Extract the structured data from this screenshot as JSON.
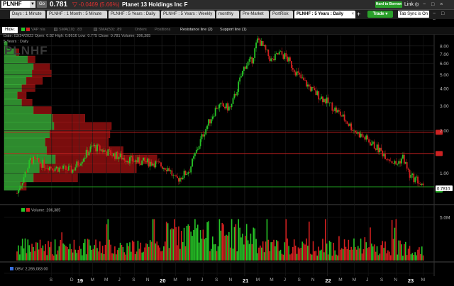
{
  "header": {
    "symbol": "PLNHF",
    "go_label": "Go",
    "price": "0.781",
    "change": "-0.0469 (5.66%)",
    "company": "Planet 13 Holdings Inc F",
    "htb_label": "Hard to Borrow",
    "link_label": "Link",
    "trade_label": "Trade",
    "tabsync_label": "Tab Sync is On",
    "win_controls": "− □ ×"
  },
  "tabs": [
    {
      "label": "Days : 1 Minute",
      "active": false
    },
    {
      "label": "PLNHF : 1 Month : 5 Minute",
      "active": false
    },
    {
      "label": "PLNHF : 5 Years : Daily",
      "active": false
    },
    {
      "label": "PLNHF : 5 Years : Weekly",
      "active": false
    },
    {
      "label": "monthly",
      "active": false
    },
    {
      "label": "Pre-Market",
      "active": false
    },
    {
      "label": "PortRisk",
      "active": false
    },
    {
      "label": "PLNHF : 5 Years : Daily",
      "active": true
    }
  ],
  "studies": {
    "hide_label": "Hide:",
    "vap": "VAP n/a",
    "sma10": "SMA(10): .83",
    "sma50": "SMA(50): .89",
    "orders": "Orders",
    "positions": "Positions",
    "resistance": "Resistance line (2)",
    "support": "Support line (1)"
  },
  "chart": {
    "stats": "Date: 03/24/2023  Open: 0.82  High: 0.8616  Low: 0.775  Close: 0.781  Volume: 206,385",
    "label": "5 Years : Daily",
    "watermark": "PLNHF",
    "volume_label": "Volume: 206,385",
    "obv_label": "OBV: 2,265,083.00",
    "vol_axis_label": "5.0M",
    "price_tag": "0.7810",
    "colors": {
      "up": "#27c427",
      "down": "#d42020",
      "vap_up": "#2e8b2e",
      "vap_down": "#7a0d0d",
      "resistance": "#cc2222",
      "support": "#22aa22"
    }
  },
  "chart_data": {
    "type": "line",
    "title": "",
    "yscale": "log",
    "ylim": [
      0.62,
      9.5
    ],
    "yticks": [
      "8.00",
      "7.00",
      "6.00",
      "5.00",
      "4.00",
      "3.00",
      "2.00",
      "1.00"
    ],
    "x": [
      "2018-04",
      "2018-06",
      "2018-09",
      "2018-12",
      "2019-03",
      "2019-06",
      "2019-09",
      "2019-12",
      "2020-02",
      "2020-03",
      "2020-05",
      "2020-07",
      "2020-09",
      "2020-11",
      "2021-01",
      "2021-02",
      "2021-03",
      "2021-05",
      "2021-06",
      "2021-07",
      "2021-09",
      "2021-11",
      "2022-01",
      "2022-03",
      "2022-05",
      "2022-07",
      "2022-09",
      "2022-11",
      "2022-12",
      "2023-01",
      "2023-02",
      "2023-03"
    ],
    "y": [
      0.72,
      1.25,
      1.1,
      1.05,
      1.55,
      1.35,
      1.22,
      1.18,
      1.08,
      0.88,
      1.05,
      1.9,
      3.0,
      2.9,
      5.8,
      6.3,
      9.0,
      6.2,
      7.1,
      6.7,
      4.8,
      3.8,
      3.2,
      2.6,
      2.0,
      1.7,
      1.4,
      1.15,
      1.3,
      0.95,
      0.9,
      0.78
    ],
    "resistance_lines": [
      1.95,
      1.38
    ],
    "support_line": 0.8,
    "volume_max": 5000000,
    "vap_levels": [
      {
        "price": 8.1,
        "up": 4,
        "down": 0
      },
      {
        "price": 7.2,
        "up": 16,
        "down": 4
      },
      {
        "price": 6.4,
        "up": 32,
        "down": 10
      },
      {
        "price": 5.7,
        "up": 40,
        "down": 22
      },
      {
        "price": 5.1,
        "up": 38,
        "down": 26
      },
      {
        "price": 4.5,
        "up": 30,
        "down": 22
      },
      {
        "price": 4.0,
        "up": 24,
        "down": 18
      },
      {
        "price": 3.55,
        "up": 18,
        "down": 12
      },
      {
        "price": 3.15,
        "up": 24,
        "down": 14
      },
      {
        "price": 2.8,
        "up": 40,
        "down": 24
      },
      {
        "price": 2.45,
        "up": 66,
        "down": 44
      },
      {
        "price": 2.15,
        "up": 68,
        "down": 78
      },
      {
        "price": 1.9,
        "up": 62,
        "down": 82
      },
      {
        "price": 1.65,
        "up": 56,
        "down": 86
      },
      {
        "price": 1.45,
        "up": 58,
        "down": 104
      },
      {
        "price": 1.25,
        "up": 70,
        "down": 138
      },
      {
        "price": 1.08,
        "up": 48,
        "down": 132
      },
      {
        "price": 0.93,
        "up": 40,
        "down": 60
      },
      {
        "price": 0.8,
        "up": 22,
        "down": 8
      }
    ],
    "x_labels": [
      {
        "t": "2018-09",
        "l": "S"
      },
      {
        "t": "2018-12",
        "l": "D"
      },
      {
        "t": "2019-01",
        "l": "19",
        "year": true
      },
      {
        "t": "2019-03",
        "l": "M"
      },
      {
        "t": "2019-05",
        "l": "M"
      },
      {
        "t": "2019-07",
        "l": "J"
      },
      {
        "t": "2019-09",
        "l": "S"
      },
      {
        "t": "2019-11",
        "l": "N"
      },
      {
        "t": "2020-01",
        "l": "20",
        "year": true
      },
      {
        "t": "2020-03",
        "l": "M"
      },
      {
        "t": "2020-05",
        "l": "M"
      },
      {
        "t": "2020-07",
        "l": "J"
      },
      {
        "t": "2020-09",
        "l": "S"
      },
      {
        "t": "2020-11",
        "l": "N"
      },
      {
        "t": "2021-01",
        "l": "21",
        "year": true
      },
      {
        "t": "2021-03",
        "l": "M"
      },
      {
        "t": "2021-05",
        "l": "M"
      },
      {
        "t": "2021-07",
        "l": "J"
      },
      {
        "t": "2021-09",
        "l": "S"
      },
      {
        "t": "2021-11",
        "l": "N"
      },
      {
        "t": "2022-01",
        "l": "22",
        "year": true
      },
      {
        "t": "2022-03",
        "l": "M"
      },
      {
        "t": "2022-05",
        "l": "M"
      },
      {
        "t": "2022-07",
        "l": "J"
      },
      {
        "t": "2022-09",
        "l": "S"
      },
      {
        "t": "2022-11",
        "l": "N"
      },
      {
        "t": "2023-01",
        "l": "23",
        "year": true
      },
      {
        "t": "2023-03",
        "l": "M"
      }
    ]
  }
}
